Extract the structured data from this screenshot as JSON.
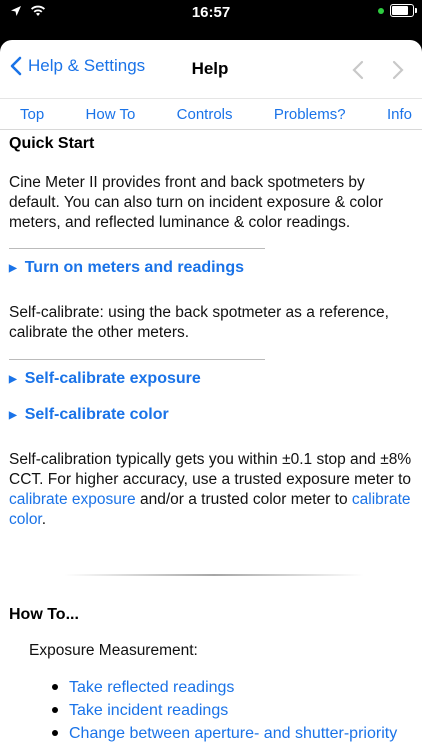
{
  "status": {
    "time": "16:57"
  },
  "nav": {
    "back_label": "Help & Settings",
    "title": "Help"
  },
  "tabs": [
    "Top",
    "How To",
    "Controls",
    "Problems?",
    "Info"
  ],
  "quick_start": {
    "heading": "Quick Start",
    "intro": "Cine Meter II provides front and back spotmeters by default. You can also turn on incident exposure & color meters, and reflected luminance & color readings.",
    "turn_on": "Turn on meters and readings",
    "self_cal_text": "Self-calibrate: using the back spotmeter as a reference, calibrate the other meters.",
    "self_cal_exposure": "Self-calibrate exposure",
    "self_cal_color": "Self-calibrate color",
    "accuracy_text_1": "Self-calibration typically gets you within ±0.1 stop and ±8% CCT. For higher accuracy, use a trusted exposure meter to ",
    "link_cal_exposure": "calibrate exposure",
    "accuracy_text_2": " and/or a trusted color meter to ",
    "link_cal_color": "calibrate color",
    "accuracy_text_3": "."
  },
  "how_to": {
    "heading": "How To...",
    "subheading": "Exposure Measurement:",
    "items": [
      "Take reflected readings",
      "Take incident readings",
      "Change between aperture- and shutter-priority"
    ]
  }
}
